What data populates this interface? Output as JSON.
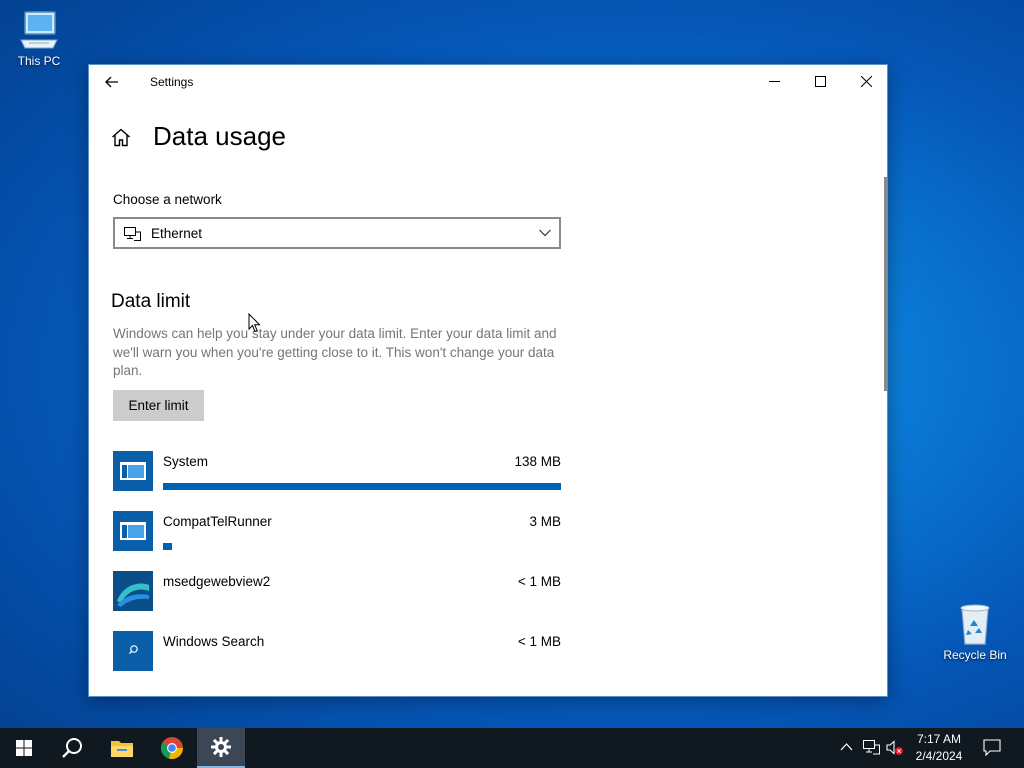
{
  "desktop": {
    "icons": [
      {
        "label": "This PC",
        "icon": "computer-icon"
      },
      {
        "label": "Recycle Bin",
        "icon": "recycle-bin-icon"
      }
    ]
  },
  "window": {
    "title": "Settings",
    "page_title": "Data usage",
    "network": {
      "label": "Choose a network",
      "selected": "Ethernet"
    },
    "data_limit": {
      "heading": "Data limit",
      "description": "Windows can help you stay under your data limit. Enter your data limit and we'll warn you when you're getting close to it. This won't change your data plan.",
      "button_label": "Enter limit"
    },
    "apps": [
      {
        "name": "System",
        "usage": "138 MB",
        "fraction": 1.0,
        "icon": "system-app-icon"
      },
      {
        "name": "CompatTelRunner",
        "usage": "3 MB",
        "fraction": 0.022,
        "icon": "system-app-icon"
      },
      {
        "name": "msedgewebview2",
        "usage": "< 1 MB",
        "fraction": 0,
        "icon": "edge-webview-icon"
      },
      {
        "name": "Windows Search",
        "usage": "< 1 MB",
        "fraction": 0,
        "icon": "search-app-icon"
      }
    ]
  },
  "taskbar": {
    "items": [
      "start-icon",
      "search-icon",
      "file-explorer-icon",
      "chrome-icon",
      "settings-icon"
    ],
    "clock": {
      "time": "7:17 AM",
      "date": "2/4/2024"
    }
  },
  "colors": {
    "accent": "#0063b1",
    "desktop": "#0a78d4",
    "taskbar": "#101820"
  }
}
